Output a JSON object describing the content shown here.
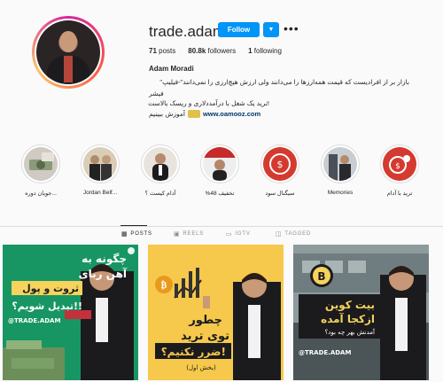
{
  "profile": {
    "username": "trade.adam",
    "follow_label": "Follow",
    "dropdown_icon": "chevron-down-icon",
    "more_icon": "more-options-icon",
    "stats": [
      {
        "count": "71",
        "label": "posts"
      },
      {
        "count": "80.8k",
        "label": "followers"
      },
      {
        "count": "1",
        "label": "following"
      }
    ],
    "full_name": "Adam Moradi",
    "bio": {
      "line1": "بازار بر از افرادیست که قیمت همه‌ارزها را می‌دانند ولی ارزش هیچ‌ارزی را نمی‌دانند\"-فیلیپ\"",
      "line2": "فیشر",
      "line3": "!ترید یک شغل با درآمددلاری و ریسک بالاست",
      "link": "www.oamooz.com",
      "link_suffix": "آموزش ببینیم"
    }
  },
  "highlights": [
    {
      "label": "جویان دوره...",
      "theme": "money"
    },
    {
      "label": "Jordan Belf...",
      "theme": "men"
    },
    {
      "label": "آدام کیست ؟",
      "theme": "portrait"
    },
    {
      "label": "%تخفیف 48",
      "theme": "flag"
    },
    {
      "label": "سیگنال سود",
      "theme": "red-signal"
    },
    {
      "label": "Memories",
      "theme": "memories"
    },
    {
      "label": "ترید با آدام",
      "theme": "red-trade"
    }
  ],
  "tabs": [
    {
      "label": "POSTS",
      "icon": "grid-icon",
      "active": true
    },
    {
      "label": "REELS",
      "icon": "reels-icon",
      "active": false
    },
    {
      "label": "IGTV",
      "icon": "igtv-icon",
      "active": false
    },
    {
      "label": "TAGGED",
      "icon": "tag-icon",
      "active": false
    }
  ],
  "posts": [
    {
      "line1": "چگونه به",
      "line2": "آهن ربای",
      "line3": "ثروت و پول",
      "line4": "تبدیل شویم؟!!",
      "handle": "@TRADE.ADAM"
    },
    {
      "line1": "چطور",
      "line2": "توی ترید",
      "line3": "ضرر نکنیم؟!",
      "line4": "(بخش اول)"
    },
    {
      "line1": "بیت کوین",
      "line2": "ازکجا آمده",
      "line3": "آمدنش بهر چه بود؟",
      "handle": "@TRADE.ADAM"
    }
  ],
  "colors": {
    "follow_blue": "#0095f6",
    "post1_bg": "#1a9e6a",
    "post2_bg": "#f6c84b",
    "post3_bg": "#8d9b9d"
  }
}
